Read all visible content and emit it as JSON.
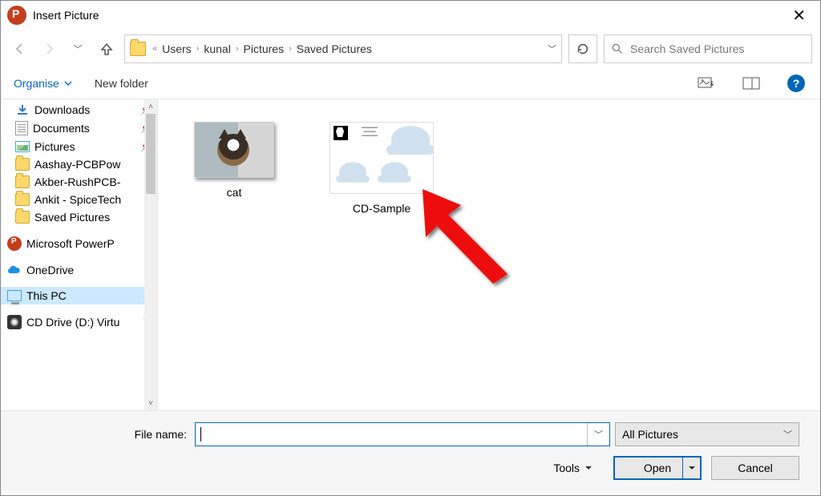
{
  "title": "Insert Picture",
  "breadcrumbs": {
    "prefix_sep": "«",
    "parts": [
      "Users",
      "kunal",
      "Pictures",
      "Saved Pictures"
    ]
  },
  "search": {
    "placeholder": "Search Saved Pictures"
  },
  "toolbar": {
    "organise": "Organise",
    "newfolder": "New folder"
  },
  "sidebar": {
    "items": [
      {
        "label": "Downloads",
        "pinned": true
      },
      {
        "label": "Documents",
        "pinned": true
      },
      {
        "label": "Pictures",
        "pinned": true
      },
      {
        "label": "Aashay-PCBPow",
        "pinned": false
      },
      {
        "label": "Akber-RushPCB-",
        "pinned": false
      },
      {
        "label": "Ankit - SpiceTech",
        "pinned": false
      },
      {
        "label": "Saved Pictures",
        "pinned": false
      },
      {
        "label": "Microsoft PowerP",
        "pinned": false
      },
      {
        "label": "OneDrive",
        "pinned": false
      },
      {
        "label": "This PC",
        "pinned": false
      },
      {
        "label": "CD Drive (D:) Virtu",
        "pinned": false
      }
    ]
  },
  "content": {
    "items": [
      {
        "label": "cat"
      },
      {
        "label": "CD-Sample"
      }
    ]
  },
  "filebar": {
    "filename_label": "File name:",
    "filename_value": "",
    "filter": "All Pictures",
    "tools": "Tools",
    "open": "Open",
    "cancel": "Cancel"
  }
}
